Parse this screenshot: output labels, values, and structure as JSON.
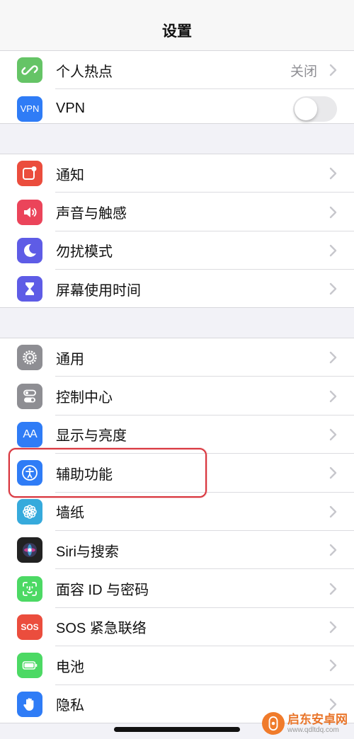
{
  "nav": {
    "title": "设置"
  },
  "groups": [
    {
      "items": [
        {
          "label": "个人热点",
          "value": "关闭",
          "icon": "hotspot-icon",
          "color": "#65c466"
        },
        {
          "label": "VPN",
          "icon": "vpn-icon",
          "icon_text": "VPN",
          "color": "#2f7cf6",
          "toggle": false
        }
      ]
    },
    {
      "items": [
        {
          "label": "通知",
          "icon": "notifications-icon",
          "color": "#eb4d3d"
        },
        {
          "label": "声音与触感",
          "icon": "speaker-icon",
          "color": "#eb445a"
        },
        {
          "label": "勿扰模式",
          "icon": "moon-icon",
          "color": "#5e5ce6"
        },
        {
          "label": "屏幕使用时间",
          "icon": "hourglass-icon",
          "color": "#5e5ce6"
        }
      ]
    },
    {
      "items": [
        {
          "label": "通用",
          "icon": "gear-icon",
          "color": "#8e8e93"
        },
        {
          "label": "控制中心",
          "icon": "switches-icon",
          "color": "#8e8e93"
        },
        {
          "label": "显示与亮度",
          "icon": "text-size-icon",
          "icon_text": "AA",
          "color": "#2f7cf6"
        },
        {
          "label": "辅助功能",
          "icon": "accessibility-icon",
          "color": "#2f7cf6"
        },
        {
          "label": "墙纸",
          "icon": "flower-icon",
          "color": "#36aadc"
        },
        {
          "label": "Siri与搜索",
          "icon": "siri-icon",
          "color": "#222222"
        },
        {
          "label": "面容 ID 与密码",
          "icon": "face-id-icon",
          "color": "#4cd964"
        },
        {
          "label": "SOS 紧急联络",
          "icon": "sos-icon",
          "icon_text": "SOS",
          "color": "#eb4d3d"
        },
        {
          "label": "电池",
          "icon": "battery-icon",
          "color": "#4cd964"
        },
        {
          "label": "隐私",
          "icon": "hand-icon",
          "color": "#2f7cf6"
        }
      ]
    }
  ],
  "watermark": {
    "name": "启东安卓网",
    "url": "www.qdltdq.com"
  },
  "colors": {
    "highlight": "#d9363e",
    "toggle_off": "#e9e9eb",
    "chevron": "#c7c7cc"
  }
}
